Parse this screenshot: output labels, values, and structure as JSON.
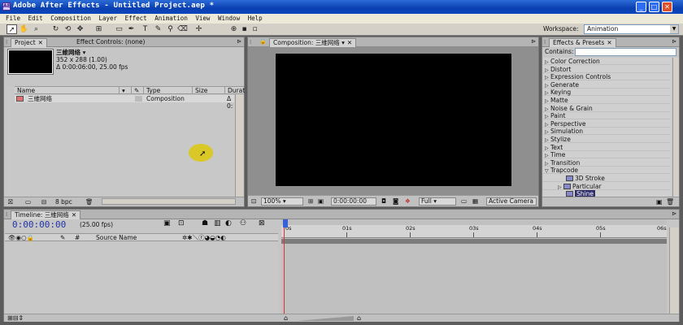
{
  "window": {
    "title": "Adobe After Effects - Untitled Project.aep *",
    "icon": "AE"
  },
  "menu": [
    "File",
    "Edit",
    "Composition",
    "Layer",
    "Effect",
    "Animation",
    "View",
    "Window",
    "Help"
  ],
  "toolbar": {
    "workspace_label": "Workspace:",
    "workspace_value": "Animation"
  },
  "project_panel": {
    "tab_project": "Project",
    "tab_effect_controls": "Effect Controls: (none)",
    "comp_name": "三維网络",
    "comp_dims": "352 x 288 (1.00)",
    "comp_duration": "Δ 0:00:06:00, 25.00 fps",
    "columns": [
      "Name",
      "Type",
      "Size",
      "Durat"
    ],
    "rows": [
      {
        "name": "三維网络",
        "type": "Composition",
        "duration": "Δ 0:"
      }
    ],
    "bpc": "8 bpc"
  },
  "composition_panel": {
    "tab": "Composition: 三維网络",
    "zoom": "100%",
    "timecode": "0:00:00:00",
    "resolution": "Full",
    "camera": "Active Camera"
  },
  "effects_panel": {
    "tab": "Effects & Presets",
    "contains_label": "Contains:",
    "items": [
      {
        "label": "Color Correction",
        "expanded": false,
        "sub": false
      },
      {
        "label": "Distort",
        "expanded": false,
        "sub": false
      },
      {
        "label": "Expression Controls",
        "expanded": false,
        "sub": false
      },
      {
        "label": "Generate",
        "expanded": false,
        "sub": false
      },
      {
        "label": "Keying",
        "expanded": false,
        "sub": false
      },
      {
        "label": "Matte",
        "expanded": false,
        "sub": false
      },
      {
        "label": "Noise & Grain",
        "expanded": false,
        "sub": false
      },
      {
        "label": "Paint",
        "expanded": false,
        "sub": false
      },
      {
        "label": "Perspective",
        "expanded": false,
        "sub": false
      },
      {
        "label": "Simulation",
        "expanded": false,
        "sub": false
      },
      {
        "label": "Stylize",
        "expanded": false,
        "sub": false
      },
      {
        "label": "Text",
        "expanded": false,
        "sub": false
      },
      {
        "label": "Time",
        "expanded": false,
        "sub": false
      },
      {
        "label": "Transition",
        "expanded": false,
        "sub": false
      },
      {
        "label": "Trapcode",
        "expanded": true,
        "sub": false
      },
      {
        "label": "3D Stroke",
        "expanded": false,
        "sub": true
      },
      {
        "label": "Particular",
        "expanded": false,
        "sub": true
      },
      {
        "label": "Shine",
        "expanded": false,
        "sub": true,
        "selected": true
      }
    ]
  },
  "timeline": {
    "tab": "Timeline: 三維网络",
    "timecode": "0:00:00:00",
    "fps": "(25.00 fps)",
    "col_hash": "#",
    "col_source": "Source Name",
    "ruler": [
      "0s",
      "01s",
      "02s",
      "03s",
      "04s",
      "05s",
      "06s"
    ]
  }
}
